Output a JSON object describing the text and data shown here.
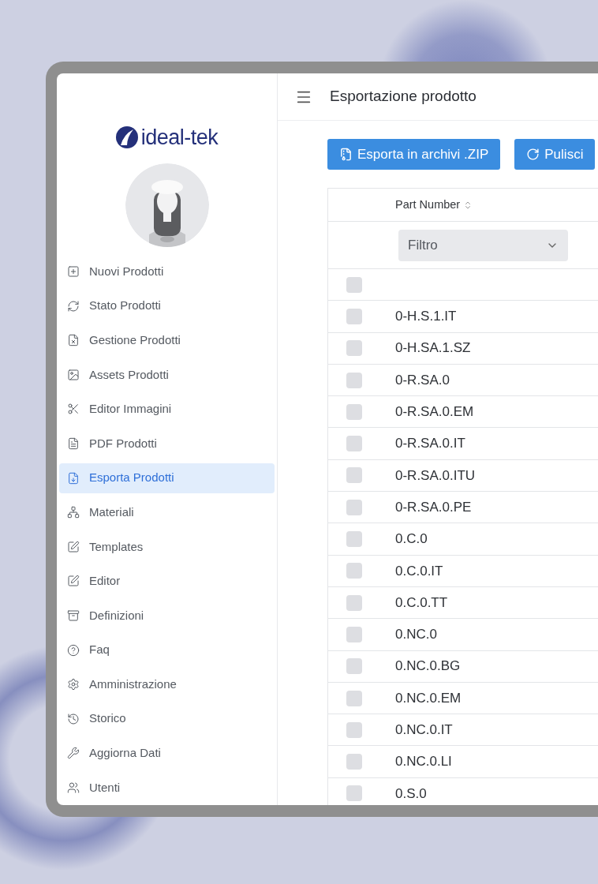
{
  "sidebar": {
    "brand": "ideal-tek",
    "items": [
      {
        "label": "Nuovi Prodotti",
        "selected": false
      },
      {
        "label": "Stato Prodotti",
        "selected": false
      },
      {
        "label": "Gestione Prodotti",
        "selected": false
      },
      {
        "label": "Assets Prodotti",
        "selected": false
      },
      {
        "label": "Editor Immagini",
        "selected": false
      },
      {
        "label": "PDF Prodotti",
        "selected": false
      },
      {
        "label": "Esporta Prodotti",
        "selected": true
      },
      {
        "label": "Materiali",
        "selected": false
      },
      {
        "label": "Templates",
        "selected": false
      },
      {
        "label": "Editor",
        "selected": false
      },
      {
        "label": "Definizioni",
        "selected": false
      },
      {
        "label": "Faq",
        "selected": false
      },
      {
        "label": "Amministrazione",
        "selected": false
      },
      {
        "label": "Storico",
        "selected": false
      },
      {
        "label": "Aggiorna Dati",
        "selected": false
      },
      {
        "label": "Utenti",
        "selected": false
      }
    ]
  },
  "header": {
    "title": "Esportazione prodotto"
  },
  "toolbar": {
    "buttons": [
      "Esporta in archivi .ZIP",
      "Pulisci"
    ]
  },
  "table": {
    "columns": [
      "Part Number"
    ],
    "filter": {
      "placeholder": "Filtro"
    },
    "rows": [
      {
        "part_number": "",
        "checked": false
      },
      {
        "part_number": "0-H.S.1.IT",
        "checked": false
      },
      {
        "part_number": "0-H.SA.1.SZ",
        "checked": false
      },
      {
        "part_number": "0-R.SA.0",
        "checked": false
      },
      {
        "part_number": "0-R.SA.0.EM",
        "checked": false
      },
      {
        "part_number": "0-R.SA.0.IT",
        "checked": false
      },
      {
        "part_number": "0-R.SA.0.ITU",
        "checked": false
      },
      {
        "part_number": "0-R.SA.0.PE",
        "checked": false
      },
      {
        "part_number": "0.C.0",
        "checked": false
      },
      {
        "part_number": "0.C.0.IT",
        "checked": false
      },
      {
        "part_number": "0.C.0.TT",
        "checked": false
      },
      {
        "part_number": "0.NC.0",
        "checked": false
      },
      {
        "part_number": "0.NC.0.BG",
        "checked": false
      },
      {
        "part_number": "0.NC.0.EM",
        "checked": false
      },
      {
        "part_number": "0.NC.0.IT",
        "checked": false
      },
      {
        "part_number": "0.NC.0.LI",
        "checked": false
      },
      {
        "part_number": "0.S.0",
        "checked": false
      }
    ]
  }
}
